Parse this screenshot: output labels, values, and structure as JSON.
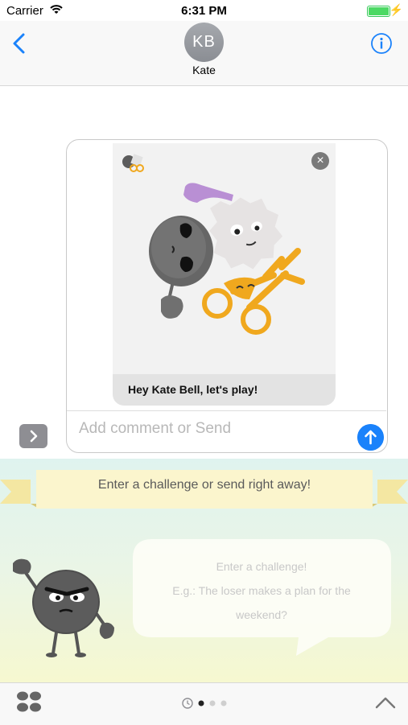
{
  "status_bar": {
    "carrier": "Carrier",
    "time": "6:31 PM"
  },
  "nav": {
    "avatar_initials": "KB",
    "contact_name": "Kate"
  },
  "compose": {
    "message_caption": "Hey Kate Bell, let's play!",
    "comment_placeholder": "Add comment or Send"
  },
  "game": {
    "banner_text": "Enter a challenge or send right away!",
    "challenge_hint_line1": "Enter a challenge!",
    "challenge_hint_line2": "E.g.: The loser makes a plan for the",
    "challenge_hint_line3": "weekend?"
  },
  "pager": {
    "page_count": 3,
    "current_page": 1
  },
  "colors": {
    "accent": "#1a82fb",
    "battery": "#4cd964",
    "scissors": "#f0a81e",
    "rock": "#5c5c5c"
  },
  "icons": [
    "back-chevron-icon",
    "info-icon",
    "close-icon",
    "expand-chevron-icon",
    "send-arrow-icon",
    "app-drawer-icon",
    "recents-clock-icon",
    "chevron-up-icon"
  ]
}
